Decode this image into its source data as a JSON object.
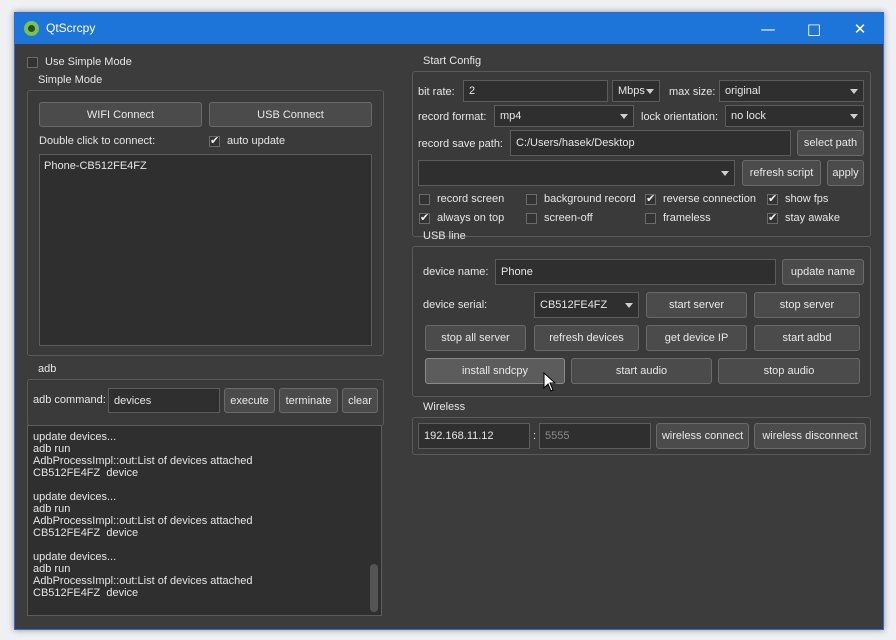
{
  "window": {
    "title": "QtScrcpy",
    "minimize_glyph": "—",
    "maximize_glyph": "□",
    "close_glyph": "✕",
    "accent_color": "#1e75d9"
  },
  "left": {
    "use_simple_mode": {
      "label": "Use Simple Mode",
      "checked": false
    },
    "simple_mode": {
      "title": "Simple Mode",
      "wifi_connect": "WIFI Connect",
      "usb_connect": "USB Connect",
      "double_click_label": "Double click to connect:",
      "auto_update": {
        "label": "auto update",
        "checked": true
      },
      "devices": [
        "Phone-CB512FE4FZ"
      ]
    },
    "adb": {
      "title": "adb",
      "command_label": "adb command:",
      "command_value": "devices",
      "execute": "execute",
      "terminate": "terminate",
      "clear": "clear",
      "log": [
        [
          "update devices...",
          "adb run",
          "AdbProcessImpl::out:List of devices attached",
          "CB512FE4FZ\tdevice"
        ],
        [
          "update devices...",
          "adb run",
          "AdbProcessImpl::out:List of devices attached",
          "CB512FE4FZ\tdevice"
        ],
        [
          "update devices...",
          "adb run",
          "AdbProcessImpl::out:List of devices attached",
          "CB512FE4FZ\tdevice"
        ]
      ]
    }
  },
  "start_config": {
    "title": "Start Config",
    "bit_rate_label": "bit rate:",
    "bit_rate_value": "2",
    "bit_rate_unit": "Mbps",
    "max_size_label": "max size:",
    "max_size_value": "original",
    "record_format_label": "record format:",
    "record_format_value": "mp4",
    "lock_orientation_label": "lock orientation:",
    "lock_orientation_value": "no lock",
    "record_save_path_label": "record save path:",
    "record_save_path_value": "C:/Users/hasek/Desktop",
    "select_path": "select path",
    "script_value": "",
    "refresh_script": "refresh script",
    "apply": "apply",
    "options": [
      {
        "label": "record screen",
        "checked": false
      },
      {
        "label": "background record",
        "checked": false
      },
      {
        "label": "reverse connection",
        "checked": true
      },
      {
        "label": "show fps",
        "checked": true
      },
      {
        "label": "always on top",
        "checked": true
      },
      {
        "label": "screen-off",
        "checked": false
      },
      {
        "label": "frameless",
        "checked": false
      },
      {
        "label": "stay awake",
        "checked": true
      }
    ]
  },
  "usb_line": {
    "title": "USB line",
    "device_name_label": "device name:",
    "device_name_value": "Phone",
    "update_name": "update name",
    "device_serial_label": "device serial:",
    "device_serial_value": "CB512FE4FZ",
    "start_server": "start server",
    "stop_server": "stop server",
    "stop_all_server": "stop all server",
    "refresh_devices": "refresh devices",
    "get_device_ip": "get device IP",
    "start_adbd": "start adbd",
    "install_sndcpy": "install sndcpy",
    "start_audio": "start audio",
    "stop_audio": "stop audio"
  },
  "wireless": {
    "title": "Wireless",
    "ip_value": "192.168.11.12",
    "separator": ":",
    "port_placeholder": "5555",
    "wireless_connect": "wireless connect",
    "wireless_disconnect": "wireless disconnect"
  }
}
